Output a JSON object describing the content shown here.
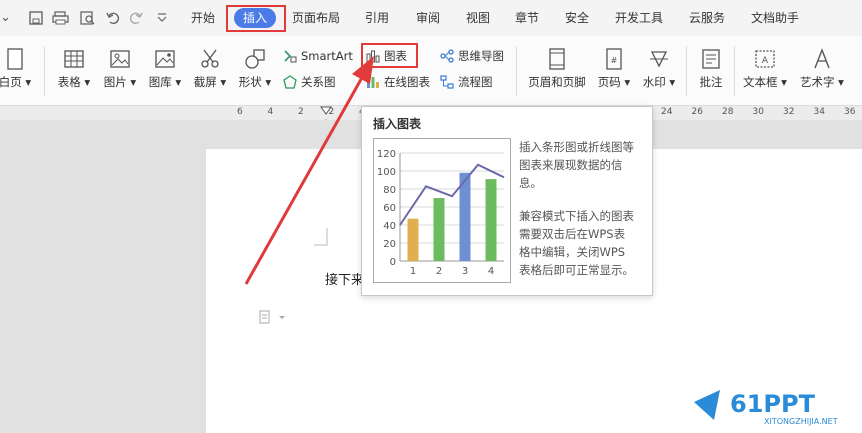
{
  "quick_access": {
    "more": "⌄"
  },
  "tabs": [
    {
      "label": "开始"
    },
    {
      "label": "插入",
      "active": true
    },
    {
      "label": "页面布局"
    },
    {
      "label": "引用"
    },
    {
      "label": "审阅"
    },
    {
      "label": "视图"
    },
    {
      "label": "章节"
    },
    {
      "label": "安全"
    },
    {
      "label": "开发工具"
    },
    {
      "label": "云服务"
    },
    {
      "label": "文档助手"
    }
  ],
  "ribbon": {
    "blank_page": "白页",
    "table": "表格",
    "picture": "图片",
    "gallery": "图库",
    "screenshot": "截屏",
    "shape": "形状",
    "smartart": "SmartArt",
    "relation": "关系图",
    "chart": "图表",
    "online_chart": "在线图表",
    "mindmap": "思维导图",
    "flowchart": "流程图",
    "header_footer": "页眉和页脚",
    "page_number": "页码",
    "watermark": "水印",
    "comment": "批注",
    "textbox": "文本框",
    "wordart": "艺术字"
  },
  "ruler": [
    "6",
    "4",
    "2",
    "2",
    "4",
    "6",
    "8",
    "10",
    "12",
    "14",
    "16",
    "18",
    "20",
    "22",
    "24",
    "26",
    "28",
    "30",
    "32",
    "34",
    "36"
  ],
  "document": {
    "text": "接下来"
  },
  "tooltip": {
    "title": "插入图表",
    "desc1": [
      "插入条形图或折线图等",
      "图表来展现数据的信",
      "息。"
    ],
    "desc2": [
      "兼容模式下插入的图表",
      "需要双击后在WPS表",
      "格中编辑，关闭WPS",
      "表格后即可正常显示。"
    ]
  },
  "chart_data": {
    "type": "bar",
    "categories": [
      "1",
      "2",
      "3",
      "4"
    ],
    "values": [
      47,
      70,
      98,
      91
    ],
    "line": [
      40,
      83,
      72,
      107,
      93
    ],
    "ylim": [
      0,
      120
    ],
    "yticks": [
      "0",
      "20",
      "40",
      "60",
      "80",
      "100",
      "120"
    ],
    "colors": [
      "#e0b050",
      "#6cbb5e",
      "#6f8fd4",
      "#6cbb5e"
    ],
    "line_color": "#6a6aa8",
    "title": "",
    "xlabel": "",
    "ylabel": ""
  },
  "watermark": {
    "logo": "61PPT",
    "url": "XITONGZHIJIA.NET"
  },
  "colors": {
    "accent": "#4a7be6",
    "highlight": "#e03a3a"
  }
}
